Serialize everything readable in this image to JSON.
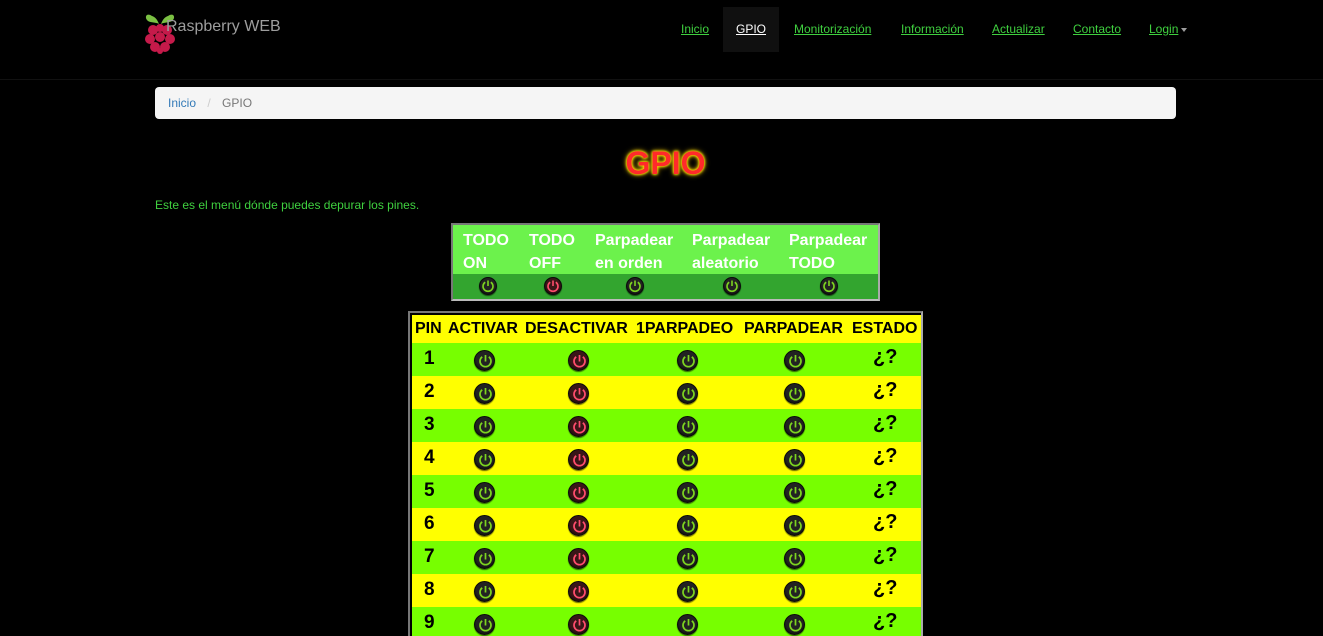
{
  "brand": {
    "title": "Raspberry WEB",
    "logo_icon": "raspberry-logo-icon"
  },
  "nav": {
    "items": [
      {
        "label": "Inicio",
        "active": false
      },
      {
        "label": "GPIO",
        "active": true
      },
      {
        "label": "Monitorización",
        "active": false
      },
      {
        "label": "Información",
        "active": false
      },
      {
        "label": "Actualizar",
        "active": false
      },
      {
        "label": "Contacto",
        "active": false
      },
      {
        "label": "Login",
        "active": false,
        "dropdown": true
      }
    ]
  },
  "breadcrumb": {
    "home": "Inicio",
    "separator": "/",
    "current": "GPIO"
  },
  "page": {
    "title": "GPIO",
    "intro": "Este es el menú dónde puedes depurar los pines."
  },
  "all_pins": {
    "headers": [
      {
        "line1": "TODO",
        "line2": "ON"
      },
      {
        "line1": "TODO",
        "line2": "OFF"
      },
      {
        "line1": "Parpadear",
        "line2": "en orden"
      },
      {
        "line1": "Parpadear",
        "line2": "aleatorio"
      },
      {
        "line1": "Parpadear",
        "line2": "TODO"
      }
    ]
  },
  "pin_table": {
    "headers": [
      "PIN",
      "ACTIVAR",
      "DESACTIVAR",
      "1PARPADEO",
      "PARPADEAR",
      "ESTADO"
    ],
    "rows": [
      {
        "pin": "1",
        "estado": "¿?"
      },
      {
        "pin": "2",
        "estado": "¿?"
      },
      {
        "pin": "3",
        "estado": "¿?"
      },
      {
        "pin": "4",
        "estado": "¿?"
      },
      {
        "pin": "5",
        "estado": "¿?"
      },
      {
        "pin": "6",
        "estado": "¿?"
      },
      {
        "pin": "7",
        "estado": "¿?"
      },
      {
        "pin": "8",
        "estado": "¿?"
      },
      {
        "pin": "9",
        "estado": "¿?"
      }
    ]
  },
  "colors": {
    "nav_link": "#3fd03f",
    "title_red": "#ff2a2a",
    "row_green": "#77ff00",
    "row_yellow": "#ffff00",
    "panel_green": "#6cf24c",
    "power_on_green": "#7cd320",
    "power_off_pink": "#ff4d6d"
  }
}
